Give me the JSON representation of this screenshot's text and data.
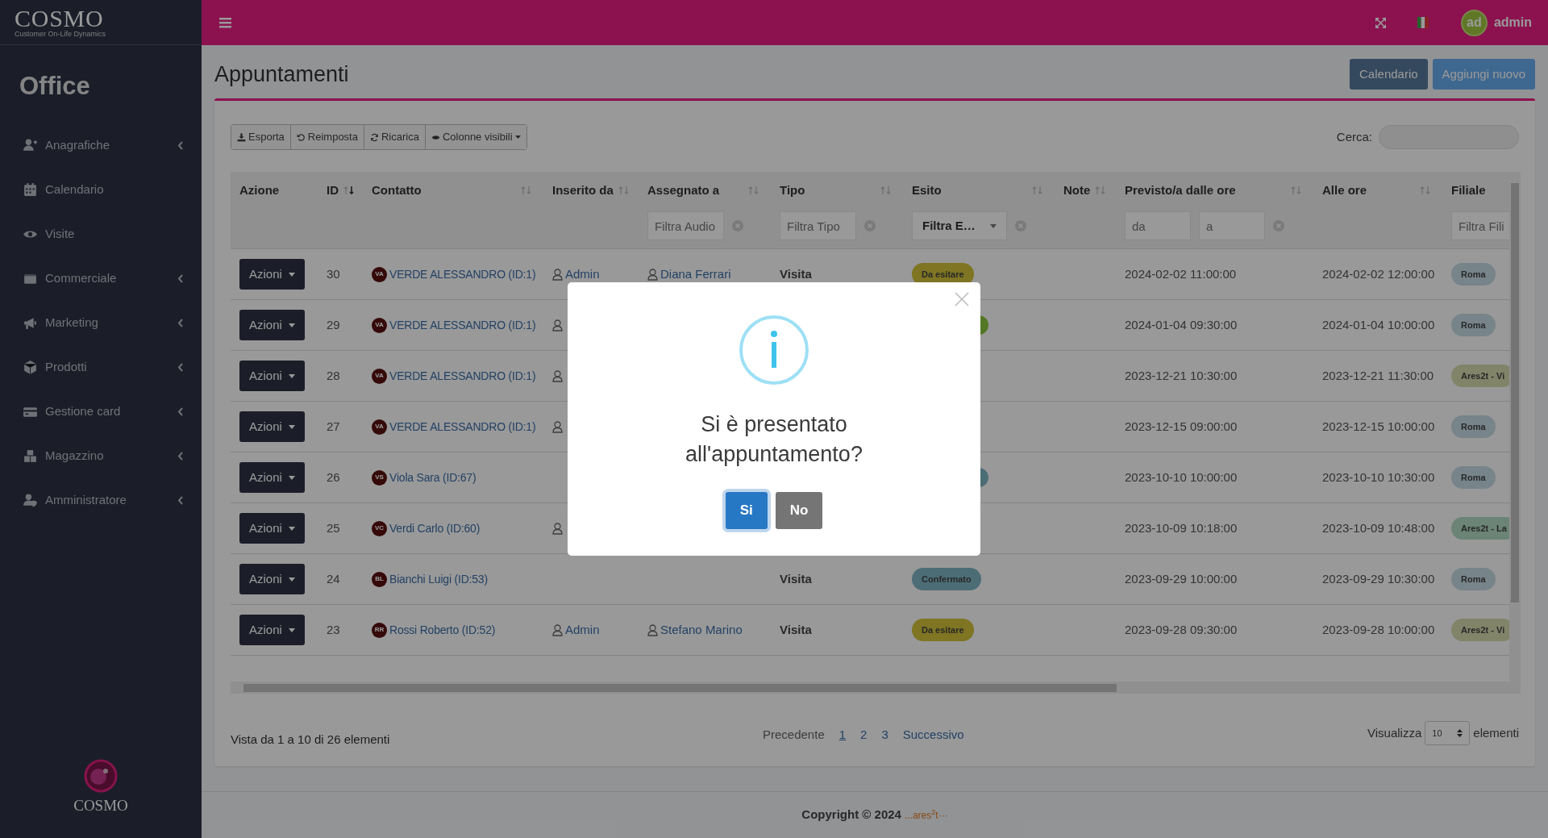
{
  "brand": {
    "logo": "COSMO",
    "tagline": "Customer On-Life Dynamics",
    "footer_logo": "COSMO"
  },
  "sidebar": {
    "title": "Office",
    "items": [
      {
        "label": "Anagrafiche",
        "expandable": true
      },
      {
        "label": "Calendario",
        "expandable": false
      },
      {
        "label": "Visite",
        "expandable": false
      },
      {
        "label": "Commerciale",
        "expandable": true
      },
      {
        "label": "Marketing",
        "expandable": true
      },
      {
        "label": "Prodotti",
        "expandable": true
      },
      {
        "label": "Gestione card",
        "expandable": true
      },
      {
        "label": "Magazzino",
        "expandable": true
      },
      {
        "label": "Amministratore",
        "expandable": true
      }
    ]
  },
  "topbar": {
    "user_initials": "ad",
    "user_name": "admin"
  },
  "page": {
    "title": "Appuntamenti",
    "buttons": [
      {
        "label": "Calendario",
        "kind": "dark"
      },
      {
        "label": "Aggiungi nuovo",
        "kind": "light"
      }
    ]
  },
  "toolbar": {
    "buttons": [
      "Esporta",
      "Reimposta",
      "Ricarica",
      "Colonne visibili"
    ],
    "search_label": "Cerca:"
  },
  "table": {
    "columns": [
      {
        "label": "Azione",
        "sortable": false
      },
      {
        "label": "ID",
        "sortable": true,
        "sorted": true
      },
      {
        "label": "Contatto",
        "sortable": true,
        "sorted": false
      },
      {
        "label": "Inserito da",
        "sortable": true,
        "sorted": false
      },
      {
        "label": "Assegnato a",
        "sortable": true,
        "sorted": false,
        "filter": {
          "kind": "text",
          "placeholders": [
            "Filtra Audio"
          ]
        }
      },
      {
        "label": "Tipo",
        "sortable": true,
        "sorted": false,
        "filter": {
          "kind": "text",
          "placeholders": [
            "Filtra Tipo"
          ]
        }
      },
      {
        "label": "Esito",
        "sortable": true,
        "sorted": false,
        "filter": {
          "kind": "select",
          "value": "Filtra E…"
        }
      },
      {
        "label": "Note",
        "sortable": true,
        "sorted": false
      },
      {
        "label": "Previsto/a dalle ore",
        "sortable": true,
        "sorted": false,
        "filter": {
          "kind": "range",
          "placeholders": [
            "da",
            "a"
          ]
        }
      },
      {
        "label": "Alle ore",
        "sortable": true,
        "sorted": false
      },
      {
        "label": "Filiale",
        "sortable": false,
        "filter": {
          "kind": "text",
          "placeholders": [
            "Filtra Fili"
          ]
        }
      }
    ],
    "rows": [
      {
        "action": "Azioni",
        "id": "30",
        "initials": "VA",
        "contact": "VERDE ALESSANDRO (ID:1)",
        "inserted_by": "Admin",
        "assigned_to": "Diana Ferrari",
        "type": "Visita",
        "outcome": {
          "label": "Da esitare",
          "kind": "pending"
        },
        "from": "2024-02-02 11:00:00",
        "to": "2024-02-02 12:00:00",
        "branch": {
          "label": "Roma",
          "kind": "city"
        }
      },
      {
        "action": "Azioni",
        "id": "29",
        "initials": "VA",
        "contact": "VERDE ALESSANDRO (ID:1)",
        "inserted_icon": true,
        "outcome": {
          "kind": "done"
        },
        "from": "2024-01-04 09:30:00",
        "to": "2024-01-04 10:00:00",
        "branch": {
          "label": "Roma",
          "kind": "city"
        }
      },
      {
        "action": "Azioni",
        "id": "28",
        "initials": "VA",
        "contact": "VERDE ALESSANDRO (ID:1)",
        "inserted_icon": true,
        "from": "2023-12-21 10:30:00",
        "to": "2023-12-21 11:30:00",
        "branch": {
          "label": "Ares2t - Vi",
          "kind": "office"
        }
      },
      {
        "action": "Azioni",
        "id": "27",
        "initials": "VA",
        "contact": "VERDE ALESSANDRO (ID:1)",
        "inserted_icon": true,
        "from": "2023-12-15 09:00:00",
        "to": "2023-12-15 10:00:00",
        "branch": {
          "label": "Roma",
          "kind": "city"
        }
      },
      {
        "action": "Azioni",
        "id": "26",
        "initials": "VS",
        "contact": "Viola Sara (ID:67)",
        "outcome": {
          "kind": "confirmed"
        },
        "from": "2023-10-10 10:00:00",
        "to": "2023-10-10 10:30:00",
        "branch": {
          "label": "Roma",
          "kind": "city"
        }
      },
      {
        "action": "Azioni",
        "id": "25",
        "initials": "VC",
        "contact": "Verdi Carlo (ID:60)",
        "inserted_icon": true,
        "from": "2023-10-09 10:18:00",
        "to": "2023-10-09 10:48:00",
        "branch": {
          "label": "Ares2t - La",
          "kind": "lab"
        }
      },
      {
        "action": "Azioni",
        "id": "24",
        "initials": "BL",
        "contact": "Bianchi Luigi (ID:53)",
        "type": "Visita",
        "outcome": {
          "label": "Confermato",
          "kind": "confirmed"
        },
        "from": "2023-09-29 10:00:00",
        "to": "2023-09-29 10:30:00",
        "branch": {
          "label": "Roma",
          "kind": "city"
        }
      },
      {
        "action": "Azioni",
        "id": "23",
        "initials": "RR",
        "contact": "Rossi Roberto (ID:52)",
        "inserted_by": "Admin",
        "assigned_to": "Stefano Marino",
        "type": "Visita",
        "outcome": {
          "label": "Da esitare",
          "kind": "pending"
        },
        "from": "2023-09-28 09:30:00",
        "to": "2023-09-28 10:00:00",
        "branch": {
          "label": "Ares2t - Vi",
          "kind": "office"
        }
      }
    ]
  },
  "footer_info": "Vista da 1 a 10 di 26 elementi",
  "pagination": {
    "previous": "Precedente",
    "pages": [
      {
        "label": "1",
        "selected": true
      },
      {
        "label": "2",
        "selected": false
      },
      {
        "label": "3",
        "selected": false
      }
    ],
    "next": "Successivo"
  },
  "page_size": {
    "label": "Visualizza",
    "value": "10",
    "suffix": "elementi"
  },
  "copyright": {
    "text": "Copyright © 2024",
    "brand": "...ares",
    "brand_sup": "2",
    "brand_end": "t···"
  },
  "modal": {
    "title": "Si è presentato all'appuntamento?",
    "buttons": [
      {
        "label": "Si",
        "kind": "primary"
      },
      {
        "label": "No",
        "kind": "secondary"
      }
    ]
  }
}
